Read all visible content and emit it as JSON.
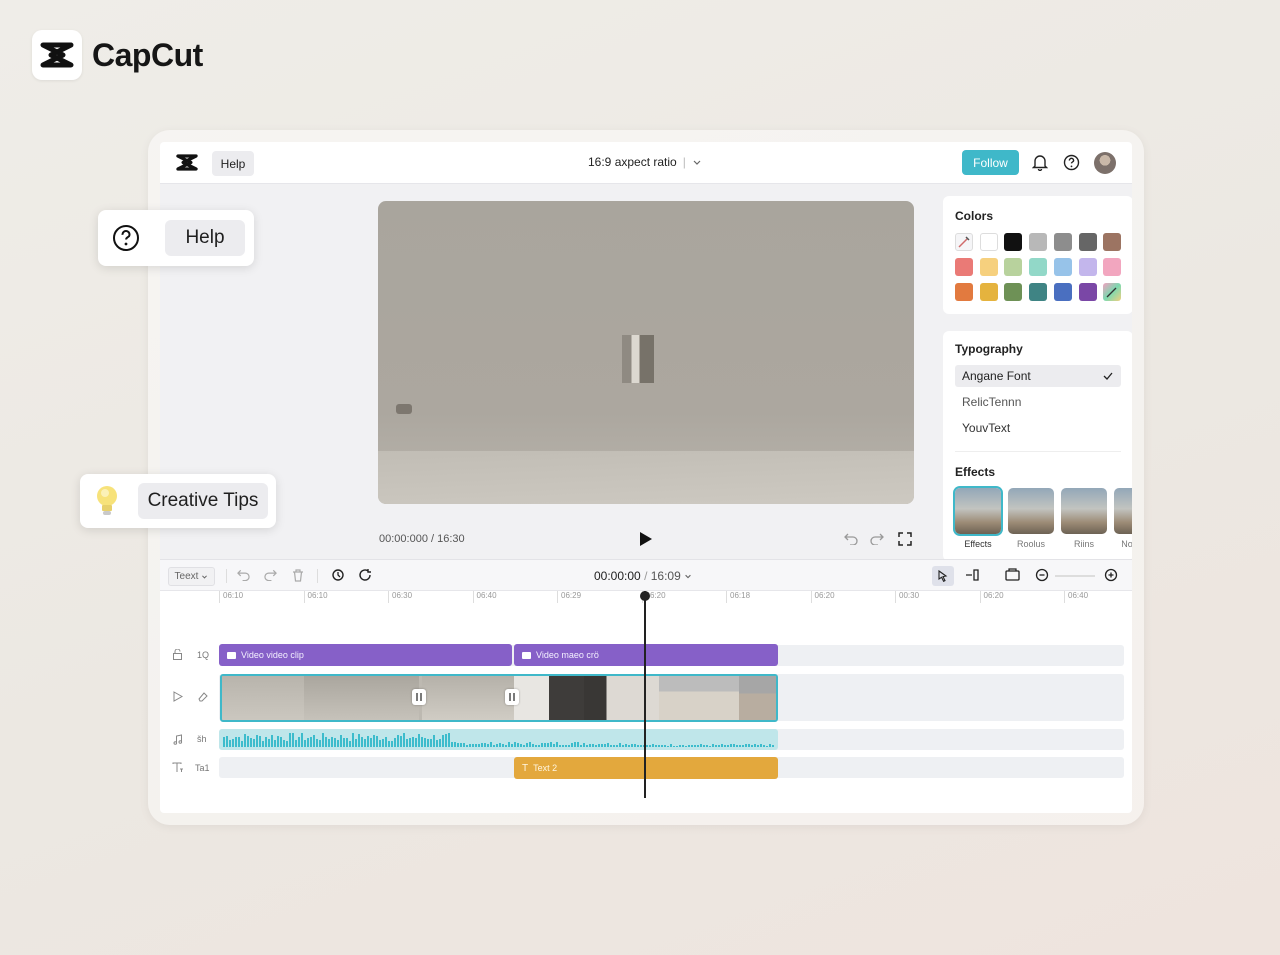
{
  "brand": {
    "name": "CapCut"
  },
  "topbar": {
    "help_label": "Help",
    "aspect_ratio_label": "16:9 axpect ratio",
    "follow_label": "Follow"
  },
  "preview": {
    "time_readout": "00:00:000 / 16:30"
  },
  "colors_panel": {
    "title": "Colors",
    "swatches": [
      "picker",
      "#ffffff",
      "#111111",
      "#b8b8b8",
      "#8d8d8d",
      "#666666",
      "#9c7462",
      "#ea7a76",
      "#f6d07e",
      "#b8d29d",
      "#92d8c8",
      "#97c3e9",
      "#c3b6ec",
      "#f2a6bf",
      "#e27a3f",
      "#e5b33e",
      "#6e9156",
      "#3f8484",
      "#4a6fc0",
      "#7a47a6",
      "gradient"
    ]
  },
  "typography_panel": {
    "title": "Typography",
    "fonts": [
      "Angane Font",
      "RelicTennn",
      "YouvText"
    ],
    "selected_font": "Angane Font"
  },
  "effects_panel": {
    "title": "Effects",
    "items": [
      "Effects",
      "Roolus",
      "Riins",
      "No"
    ]
  },
  "timeline": {
    "text_select": "Teext",
    "timecode_current": "00:00:00",
    "timecode_total": "16:09",
    "ruler_ticks": [
      "06:10",
      "06:10",
      "06:30",
      "06:40",
      "06:29",
      "06:20",
      "06:18",
      "06:20",
      "00:30",
      "06:20",
      "06:40"
    ],
    "track_labels": {
      "video1_num": "1Q",
      "audio_label": "šh",
      "text_label": "Ta1"
    },
    "clips": {
      "video1_a": "Video video clip",
      "video1_b": "Video maeo crö",
      "text2": "Text 2"
    }
  },
  "floating": {
    "help_label": "Help",
    "tips_label": "Creative Tips"
  }
}
